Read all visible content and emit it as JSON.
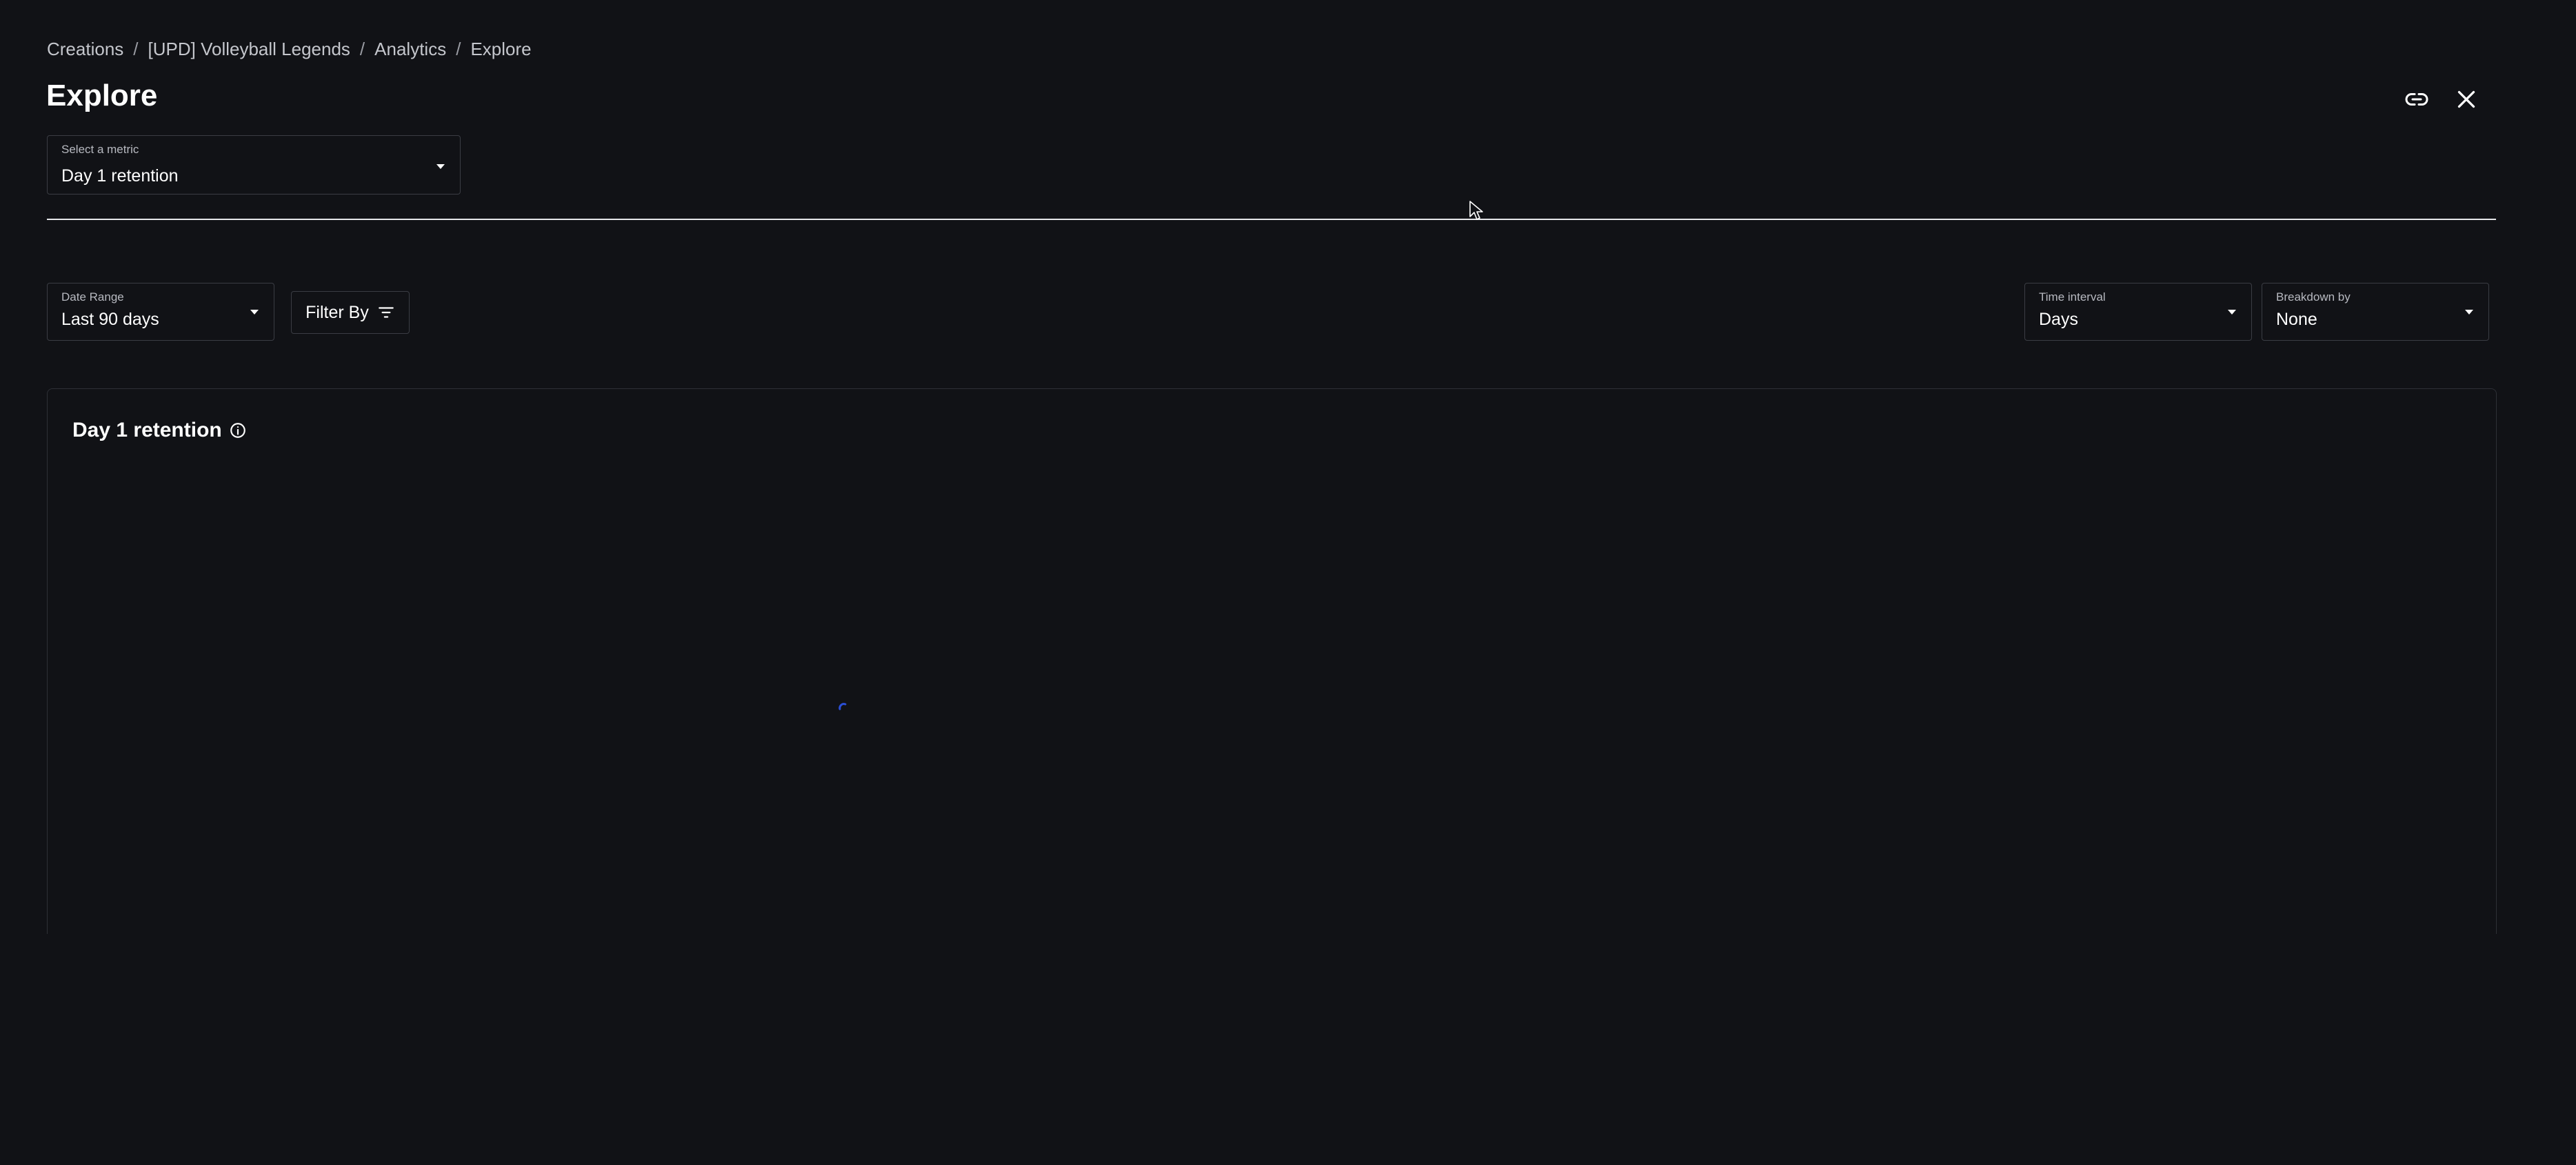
{
  "breadcrumb": {
    "items": [
      "Creations",
      "[UPD] Volleyball Legends",
      "Analytics",
      "Explore"
    ],
    "separator": "/"
  },
  "page": {
    "title": "Explore"
  },
  "header_actions": {
    "link_icon": "link-icon",
    "close_icon": "close-icon"
  },
  "metric_select": {
    "label": "Select a metric",
    "value": "Day 1 retention"
  },
  "filters": {
    "date_range": {
      "label": "Date Range",
      "value": "Last 90 days"
    },
    "filter_by": {
      "label": "Filter By",
      "icon": "filter-icon"
    },
    "time_interval": {
      "label": "Time interval",
      "value": "Days"
    },
    "breakdown_by": {
      "label": "Breakdown by",
      "value": "None"
    }
  },
  "chart": {
    "title": "Day 1 retention",
    "info_icon": "info-icon",
    "state": "loading"
  },
  "colors": {
    "background": "#111216",
    "text": "#ffffff",
    "border": "#3b3d44",
    "spinner": "#2b4fd6"
  }
}
